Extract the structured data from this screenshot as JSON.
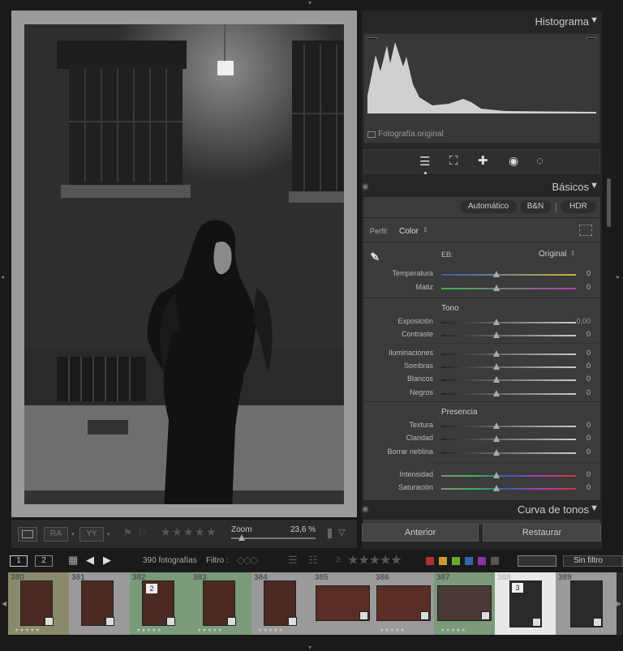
{
  "histogram": {
    "title": "Histograma",
    "original_photo_label": "Fotografía original"
  },
  "tools": {
    "items": [
      "edit-sliders-icon",
      "crop-icon",
      "healing-icon",
      "redeye-icon",
      "masking-icon"
    ]
  },
  "basic": {
    "title": "Básicos",
    "auto_label": "Automático",
    "bw_label": "B&N",
    "hdr_label": "HDR",
    "profile_label": "Perfil:",
    "profile_value": "Color",
    "wb_label": "EB:",
    "wb_value": "Original",
    "tone_label": "Tono",
    "presence_label": "Presencia",
    "sliders": [
      {
        "label": "Temperatura",
        "value": "0"
      },
      {
        "label": "Matiz",
        "value": "0"
      },
      {
        "label": "Exposición",
        "value": "0,00"
      },
      {
        "label": "Contraste",
        "value": "0"
      },
      {
        "label": "Iluminaciones",
        "value": "0"
      },
      {
        "label": "Sombras",
        "value": "0"
      },
      {
        "label": "Blancos",
        "value": "0"
      },
      {
        "label": "Negros",
        "value": "0"
      },
      {
        "label": "Textura",
        "value": "0"
      },
      {
        "label": "Claridad",
        "value": "0"
      },
      {
        "label": "Borrar neblina",
        "value": "0"
      },
      {
        "label": "Intensidad",
        "value": "0"
      },
      {
        "label": "Saturación",
        "value": "0"
      }
    ]
  },
  "tone_curve": {
    "title": "Curva de tonos"
  },
  "actions": {
    "previous": "Anterior",
    "reset": "Restaurar"
  },
  "toolbar": {
    "zoom_label": "Zoom",
    "zoom_value": "23,6 %",
    "compare_ra": "RA",
    "compare_yy": "YY"
  },
  "filmstrip_nav": {
    "screen1": "1",
    "screen2": "2",
    "count": "390 fotografías",
    "filter_label": "Filtro :",
    "filter_value": "Sin filtro",
    "colors": [
      "#a33",
      "#c93",
      "#6a3",
      "#36a",
      "#83a",
      "#555"
    ]
  },
  "filmstrip": {
    "cells": [
      {
        "num": "380",
        "stars": "★★★★★"
      },
      {
        "num": "381",
        "stars": ""
      },
      {
        "num": "382",
        "stars": "★★★★★",
        "label": "2"
      },
      {
        "num": "383",
        "stars": "★★★★★"
      },
      {
        "num": "384",
        "stars": "★★★★★"
      },
      {
        "num": "385",
        "stars": ""
      },
      {
        "num": "386",
        "stars": "★★★★★"
      },
      {
        "num": "387",
        "stars": "★★★★★"
      },
      {
        "num": "388",
        "stars": "",
        "label": "3"
      },
      {
        "num": "389",
        "stars": ""
      }
    ]
  }
}
